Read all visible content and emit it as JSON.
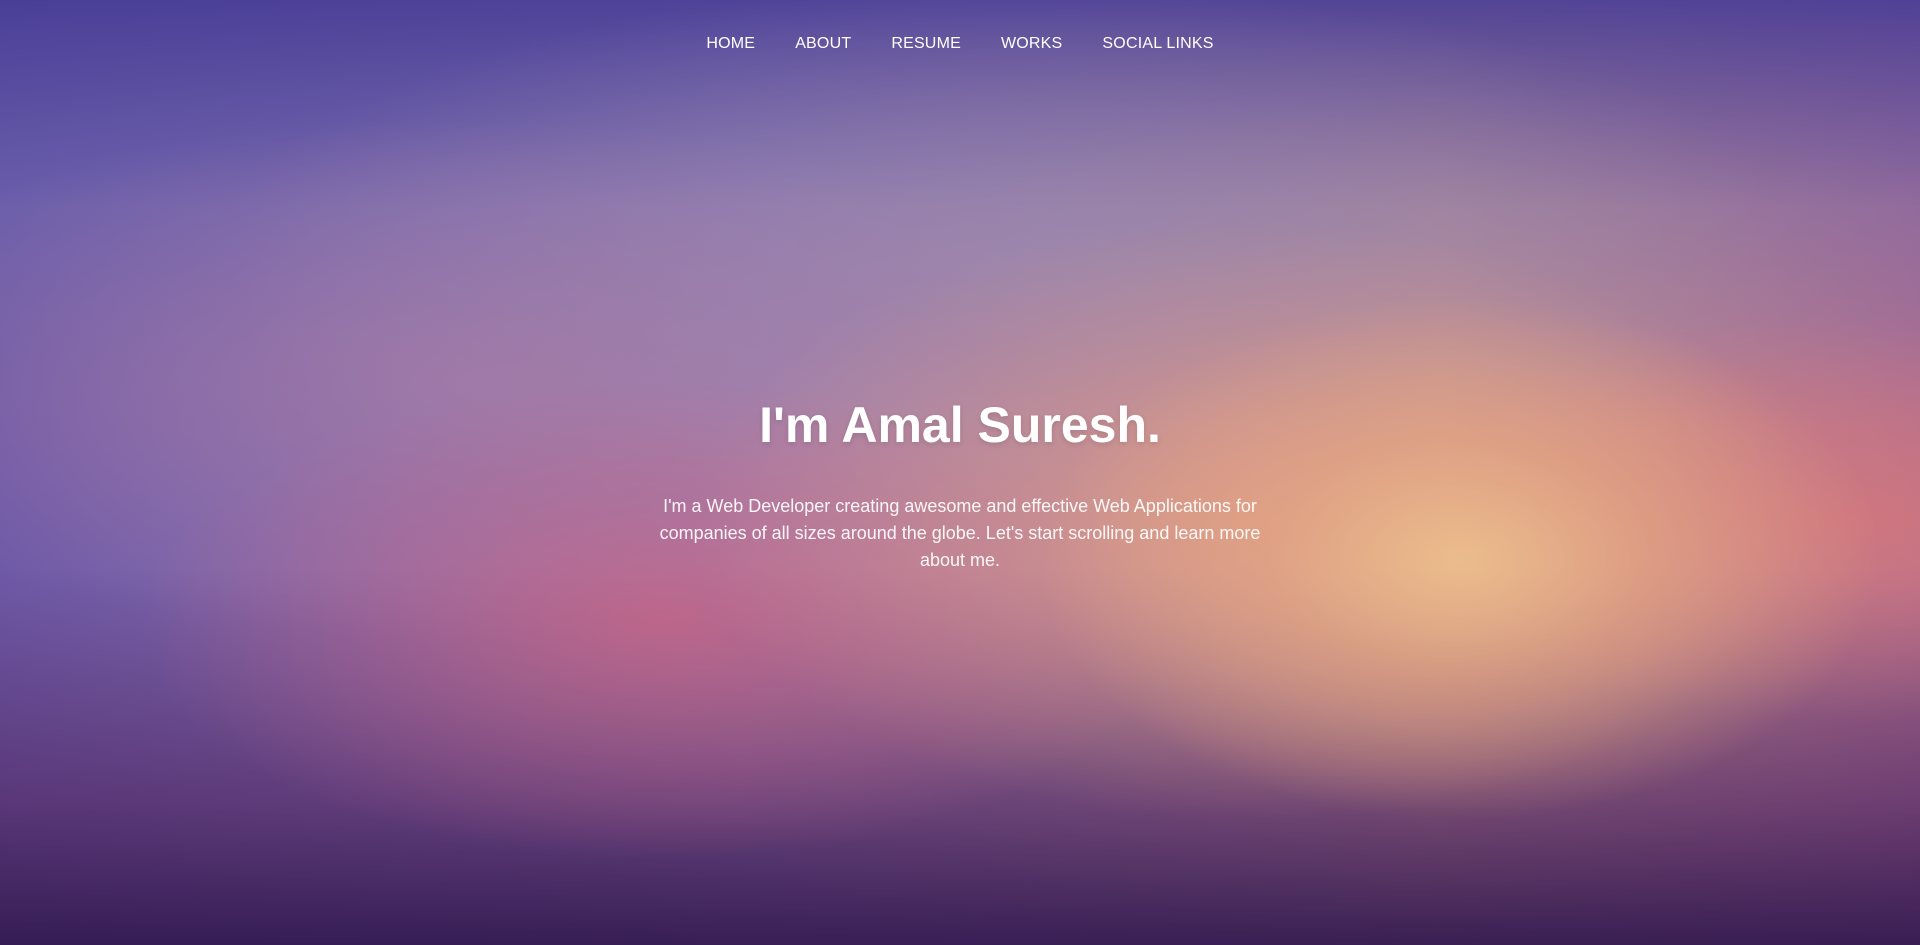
{
  "nav": {
    "items": [
      {
        "label": "HOME"
      },
      {
        "label": "ABOUT"
      },
      {
        "label": "RESUME"
      },
      {
        "label": "WORKS"
      },
      {
        "label": "SOCIAL LINKS"
      }
    ]
  },
  "hero": {
    "title": "I'm Amal Suresh.",
    "intro": "I'm a Web Developer creating awesome and effective Web Applications for companies of all sizes around the globe. Let's start scrolling and learn more about me."
  },
  "colors": {
    "text": "#ffffff",
    "top": "#4f47a0",
    "middle_glow": "#e8b98c",
    "bottom": "#341d57"
  }
}
